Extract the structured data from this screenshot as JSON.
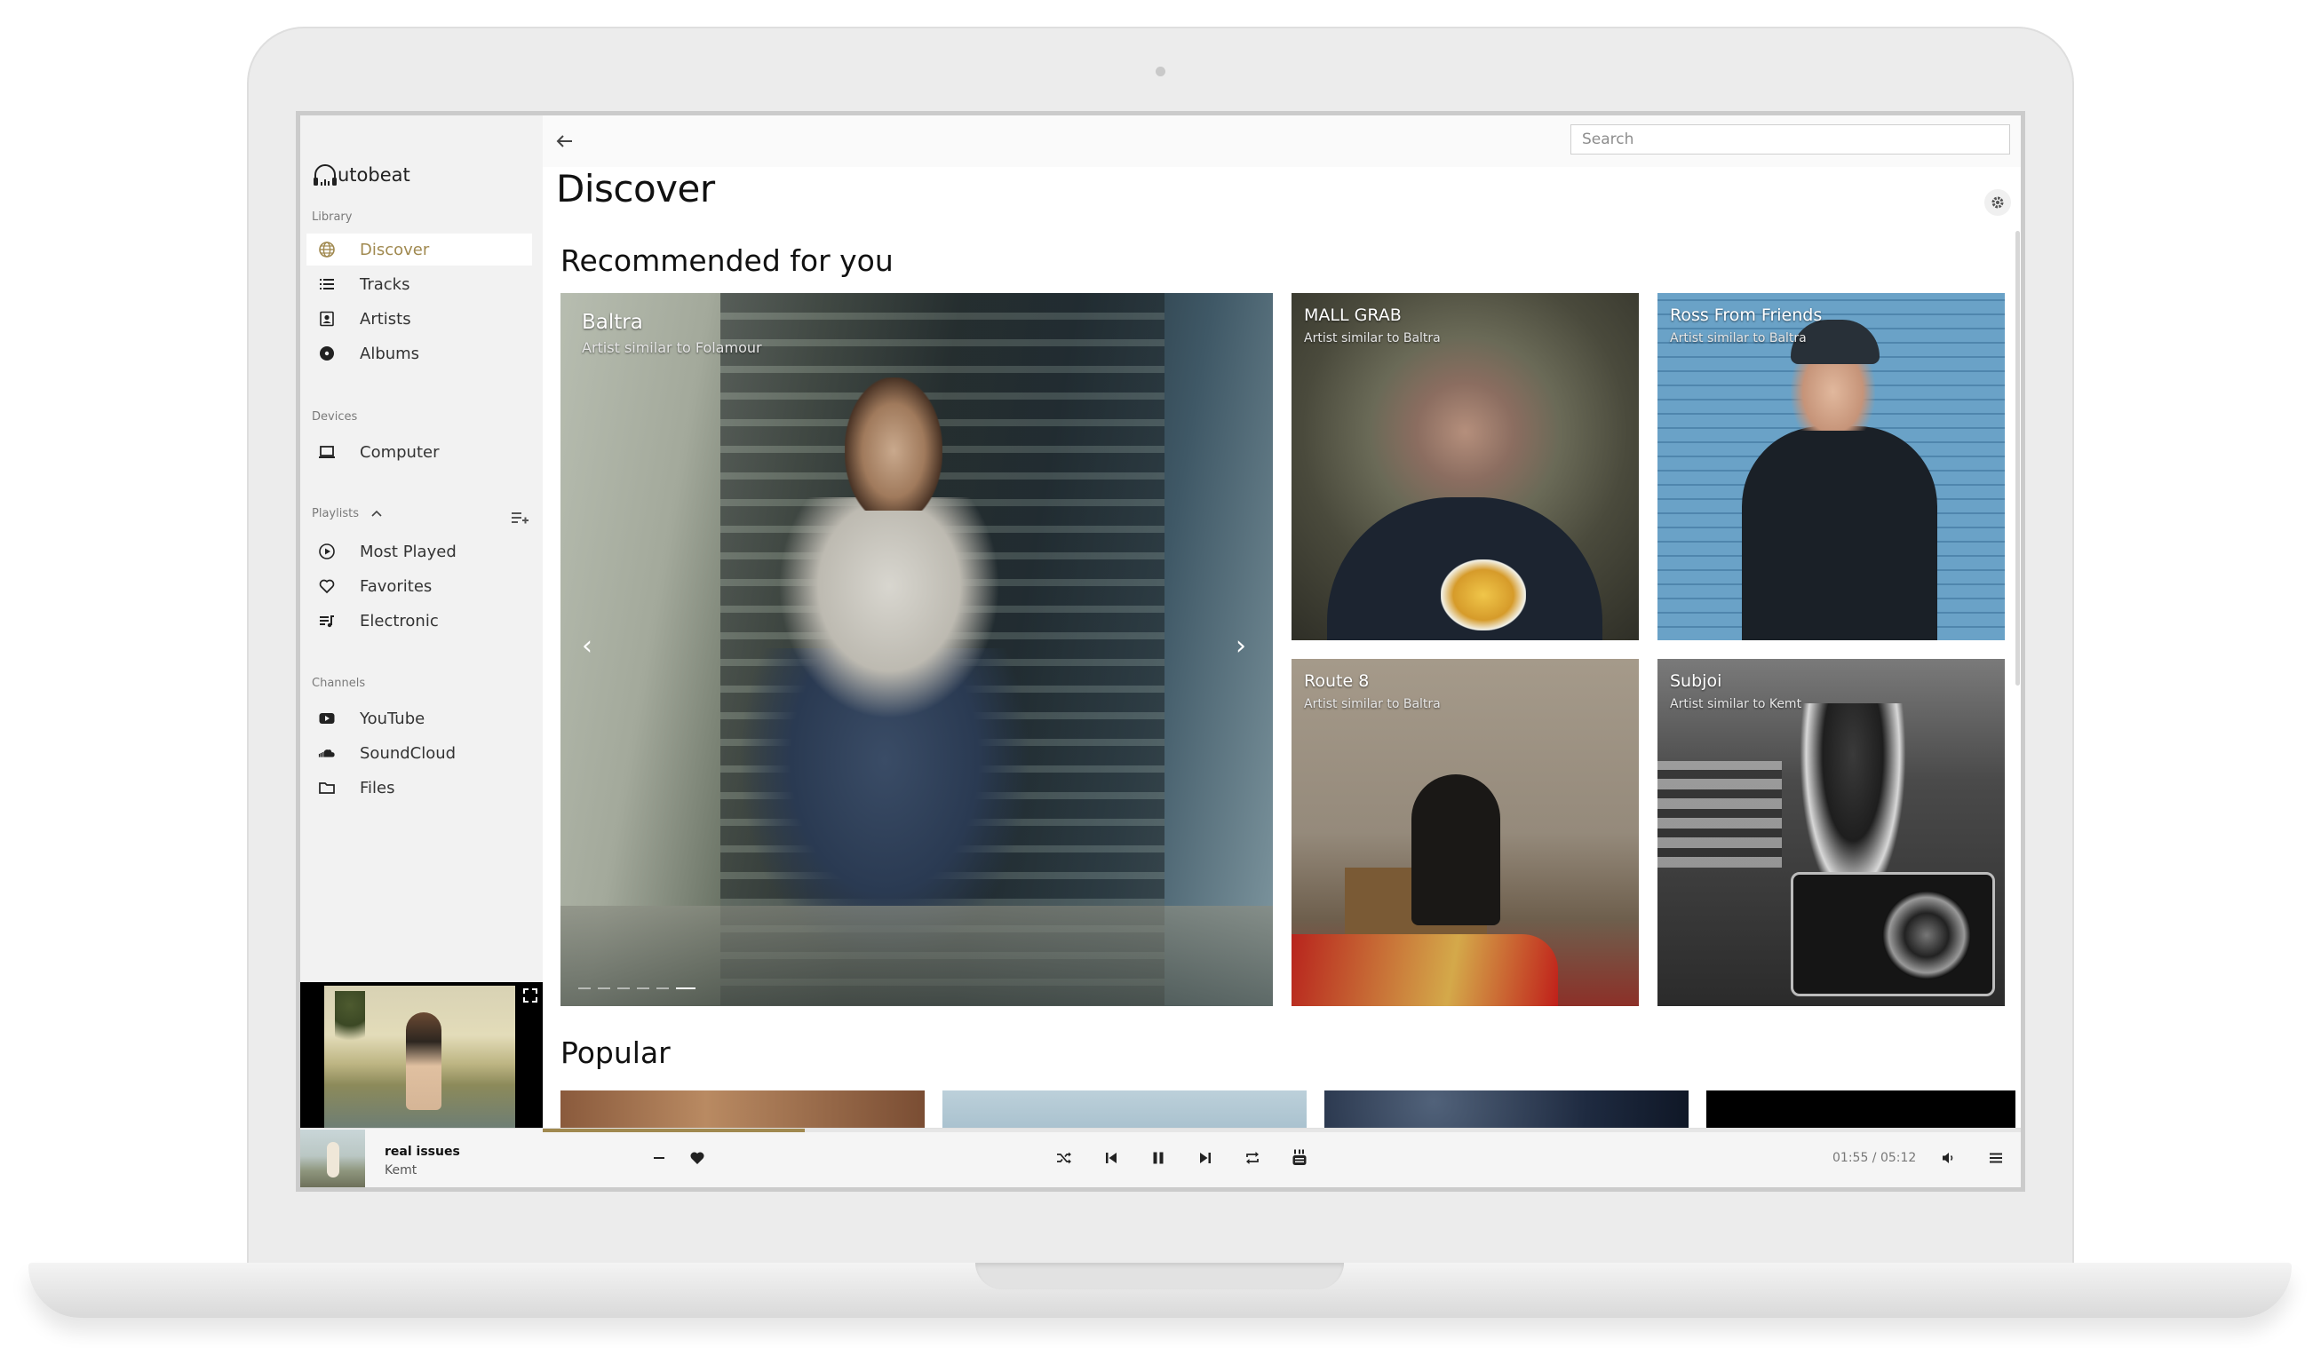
{
  "app": {
    "logo_text": "utobeat",
    "colors": {
      "accent": "#a0894f",
      "sidebar_bg": "#f2f2f2",
      "text": "#111111"
    }
  },
  "sidebar": {
    "library_label": "Library",
    "library_items": [
      {
        "label": "Discover",
        "icon": "globe-icon",
        "active": true
      },
      {
        "label": "Tracks",
        "icon": "list-icon"
      },
      {
        "label": "Artists",
        "icon": "contact-icon"
      },
      {
        "label": "Albums",
        "icon": "disc-icon"
      }
    ],
    "devices_label": "Devices",
    "devices_items": [
      {
        "label": "Computer",
        "icon": "laptop-icon"
      }
    ],
    "playlists_label": "Playlists",
    "playlists_items": [
      {
        "label": "Most Played",
        "icon": "play-circle-icon"
      },
      {
        "label": "Favorites",
        "icon": "heart-outline-icon"
      },
      {
        "label": "Electronic",
        "icon": "queue-music-icon"
      }
    ],
    "channels_label": "Channels",
    "channels_items": [
      {
        "label": "YouTube",
        "icon": "youtube-icon"
      },
      {
        "label": "SoundCloud",
        "icon": "soundcloud-icon"
      },
      {
        "label": "Files",
        "icon": "folder-icon"
      }
    ]
  },
  "header": {
    "search_placeholder": "Search",
    "title": "Discover"
  },
  "recommended": {
    "heading": "Recommended for you",
    "featured": {
      "name": "Baltra",
      "subtitle": "Artist similar to Folamour"
    },
    "carousel": {
      "slides": 6,
      "active": 6
    },
    "cards": [
      {
        "name": "MALL GRAB",
        "subtitle": "Artist similar to Baltra"
      },
      {
        "name": "Ross From Friends",
        "subtitle": "Artist similar to Baltra"
      },
      {
        "name": "Route 8",
        "subtitle": "Artist similar to Baltra"
      },
      {
        "name": "Subjoi",
        "subtitle": "Artist similar to Kemt"
      }
    ]
  },
  "popular": {
    "heading": "Popular"
  },
  "player": {
    "title": "real issues",
    "artist": "Kemt",
    "time": "01:55 / 05:12",
    "progress": 0.177
  }
}
